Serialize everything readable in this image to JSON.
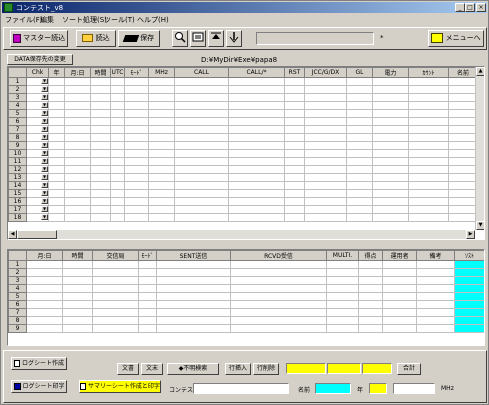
{
  "window": {
    "title": "コンテスト_v8"
  },
  "titlebar_buttons": {
    "minimize": "_",
    "maximize": "□",
    "close": "×"
  },
  "menu": [
    "ファイル(F)",
    "編集",
    "ソート処理(S)",
    "ツール(T)",
    "ヘルプ(H)"
  ],
  "toolbar": {
    "master_load": "マスター読込",
    "load": "読込",
    "save": "保存",
    "asterisk": "*",
    "menu_button": "メニューへ"
  },
  "path_bar": {
    "button": "DATA保存先の変更",
    "path": "D:¥MyDir¥Exe¥papa8"
  },
  "top_grid": {
    "headers": [
      "",
      "Chk",
      "年",
      "月:日",
      "時間",
      "UTC",
      "ﾓｰﾄﾞ",
      "MHz",
      "CALL",
      "CALL/*",
      "RST",
      "JCC/G/DX",
      "GL",
      "電力",
      "ｶｳﾝﾄ",
      "名前"
    ],
    "rows": [
      "1",
      "2",
      "3",
      "4",
      "5",
      "6",
      "7",
      "8",
      "9",
      "10",
      "11",
      "12",
      "13",
      "14",
      "15",
      "16",
      "17",
      "18"
    ],
    "dropdown_glyph": "▼"
  },
  "bottom_grid": {
    "headers": [
      "",
      "月:日",
      "時間",
      "交信局",
      "ﾓｰﾄﾞ",
      "SENT送信",
      "RCVD受信",
      "MULTI.",
      "得点",
      "運用者",
      "備考",
      "ｿｽﾄ"
    ],
    "rows": [
      "1",
      "2",
      "3",
      "4",
      "5",
      "6",
      "7",
      "8",
      "9"
    ]
  },
  "bottom_bar": {
    "log_create": "ログシート作成",
    "log_print": "ログシート印字",
    "summary_sheet": "サマリーシート作成と印字",
    "bunsho": "文書",
    "bunmatsu": "文末",
    "search": "◆不明検索",
    "row_insert": "行挿入",
    "row_delete": "行削除",
    "total": "合計",
    "contest_label": "コンテスト",
    "name_label": "名前",
    "year_label": "年",
    "mhz_label": "MHz"
  },
  "colors": {
    "title_start": "#0a246a",
    "title_end": "#a6caf0",
    "cyan": "#00ffff",
    "yellow": "#ffff00"
  }
}
